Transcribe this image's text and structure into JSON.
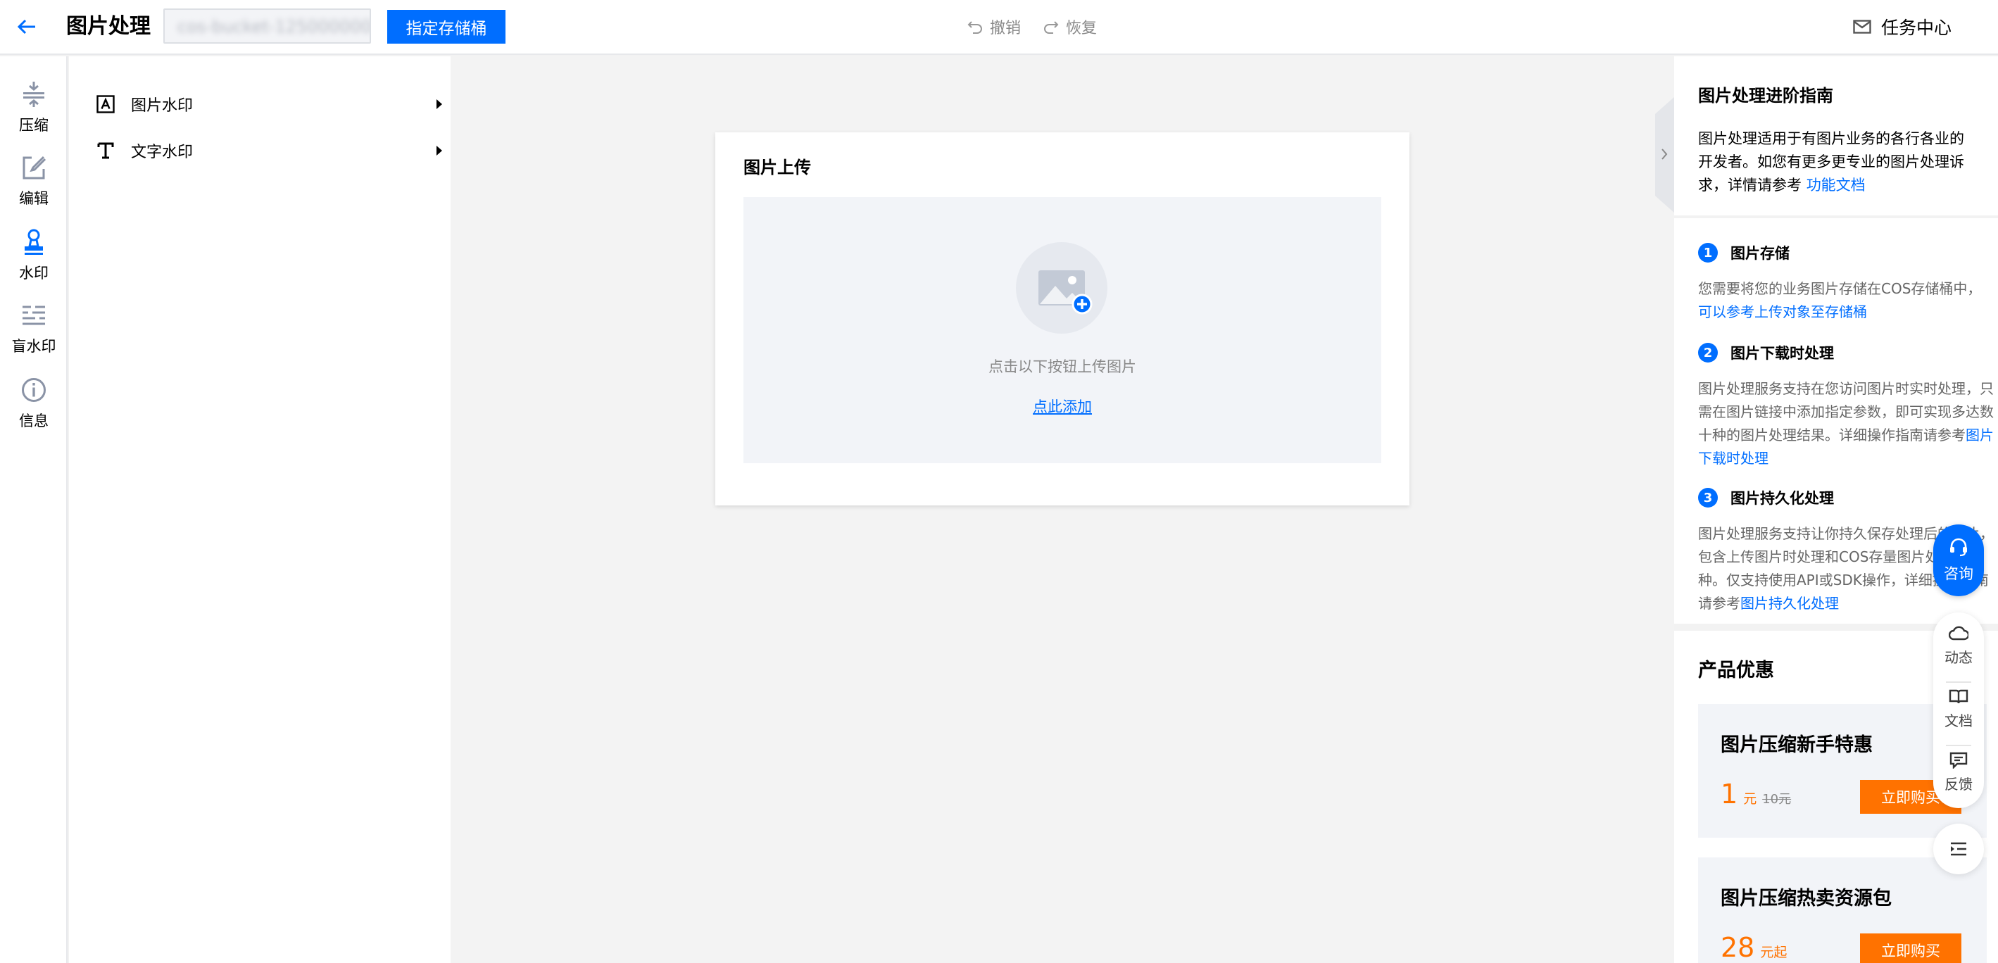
{
  "header": {
    "title": "图片处理",
    "bucket_value": "cos-bucket-1250000000",
    "assign_bucket_label": "指定存储桶",
    "undo_label": "撤销",
    "redo_label": "恢复",
    "task_center_label": "任务中心"
  },
  "rail": {
    "items": [
      {
        "label": "压缩",
        "icon": "compress-icon"
      },
      {
        "label": "编辑",
        "icon": "edit-icon"
      },
      {
        "label": "水印",
        "icon": "stamp-icon",
        "active": true
      },
      {
        "label": "盲水印",
        "icon": "blind-watermark-icon"
      },
      {
        "label": "信息",
        "icon": "info-icon"
      }
    ]
  },
  "tools": {
    "items": [
      {
        "label": "图片水印",
        "icon": "image-watermark-icon"
      },
      {
        "label": "文字水印",
        "icon": "text-watermark-icon"
      }
    ]
  },
  "upload": {
    "title": "图片上传",
    "hint": "点击以下按钮上传图片",
    "link": "点此添加"
  },
  "guide": {
    "title": "图片处理进阶指南",
    "intro": "图片处理适用于有图片业务的各行各业的开发者。如您有更多更专业的图片处理诉求，详情请参考",
    "intro_link": "功能文档",
    "steps": [
      {
        "num": "1",
        "title": "图片存储",
        "body": "您需要将您的业务图片存储在COS存储桶中，",
        "link": "可以参考上传对象至存储桶"
      },
      {
        "num": "2",
        "title": "图片下载时处理",
        "body": "图片处理服务支持在您访问图片时实时处理，只需在图片链接中添加指定参数，即可实现多达数十种的图片处理结果。详细操作指南请参考",
        "link": "图片下载时处理"
      },
      {
        "num": "3",
        "title": "图片持久化处理",
        "body": "图片处理服务支持让你持久保存处理后的图片，包含上传图片时处理和COS存量图片处理两种。仅支持使用API或SDK操作，详细操作指南请参考",
        "link": "图片持久化处理"
      }
    ]
  },
  "promo": {
    "title": "产品优惠",
    "cards": [
      {
        "title": "图片压缩新手特惠",
        "amount": "1",
        "unit": "元",
        "original": "10元",
        "button": "立即购买"
      },
      {
        "title": "图片压缩热卖资源包",
        "amount": "28",
        "unit": "元起",
        "original": "",
        "button": "立即购买"
      }
    ]
  },
  "floating": {
    "consult": "咨询",
    "news": "动态",
    "docs": "文档",
    "feedback": "反馈"
  },
  "colors": {
    "brand": "#006eff",
    "accent": "#ff7200"
  }
}
